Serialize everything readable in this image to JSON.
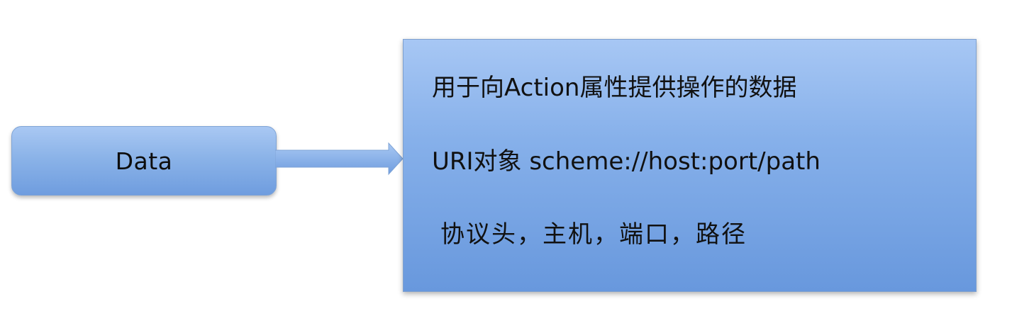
{
  "diagram": {
    "source_node": {
      "label": "Data"
    },
    "target_box": {
      "lines": [
        "用于向Action属性提供操作的数据",
        "URI对象 scheme://host:port/path",
        "协议头，主机，端口，路径"
      ]
    },
    "colors": {
      "box_top": "#a7c7f4",
      "box_bottom": "#6898dd",
      "arrow_fill": "#8bb3e8",
      "text": "#111111"
    }
  }
}
